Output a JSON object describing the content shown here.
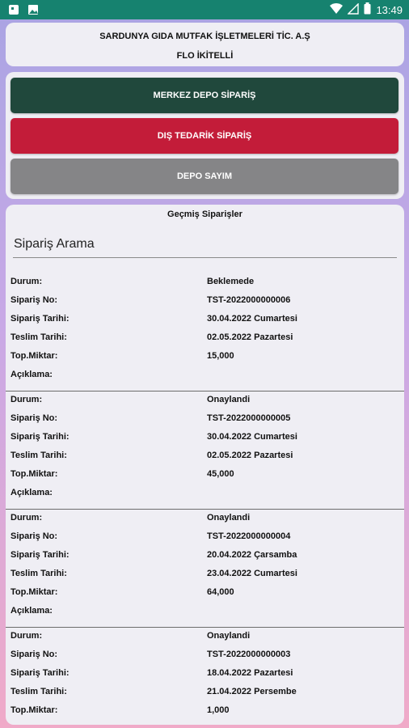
{
  "statusbar": {
    "time": "13:49"
  },
  "header": {
    "company": "SARDUNYA GIDA MUTFAK İŞLETMELERİ  TİC. A.Ş",
    "branch": "FLO İKİTELLİ"
  },
  "buttons": {
    "central": "MERKEZ DEPO SİPARİŞ",
    "external": "DIŞ TEDARİK SİPARİŞ",
    "count": "DEPO SAYIM"
  },
  "orders": {
    "title": "Geçmiş Siparişler",
    "search_placeholder": "Sipariş Arama",
    "labels": {
      "status": "Durum:",
      "order_no": "Sipariş No:",
      "order_date": "Sipariş Tarihi:",
      "delivery_date": "Teslim Tarihi:",
      "total_qty": "Top.Miktar:",
      "note": "Açıklama:"
    },
    "items": [
      {
        "status": "Beklemede",
        "order_no": "TST-2022000000006",
        "order_date": "30.04.2022 Cumartesi",
        "delivery_date": "02.05.2022 Pazartesi",
        "total_qty": "15,000",
        "note": ""
      },
      {
        "status": "Onaylandi",
        "order_no": "TST-2022000000005",
        "order_date": "30.04.2022 Cumartesi",
        "delivery_date": "02.05.2022 Pazartesi",
        "total_qty": "45,000",
        "note": ""
      },
      {
        "status": "Onaylandi",
        "order_no": "TST-2022000000004",
        "order_date": "20.04.2022 Çarsamba",
        "delivery_date": "23.04.2022 Cumartesi",
        "total_qty": "64,000",
        "note": ""
      },
      {
        "status": "Onaylandi",
        "order_no": "TST-2022000000003",
        "order_date": "18.04.2022 Pazartesi",
        "delivery_date": "21.04.2022 Persembe",
        "total_qty": "1,000",
        "note": ""
      }
    ]
  }
}
